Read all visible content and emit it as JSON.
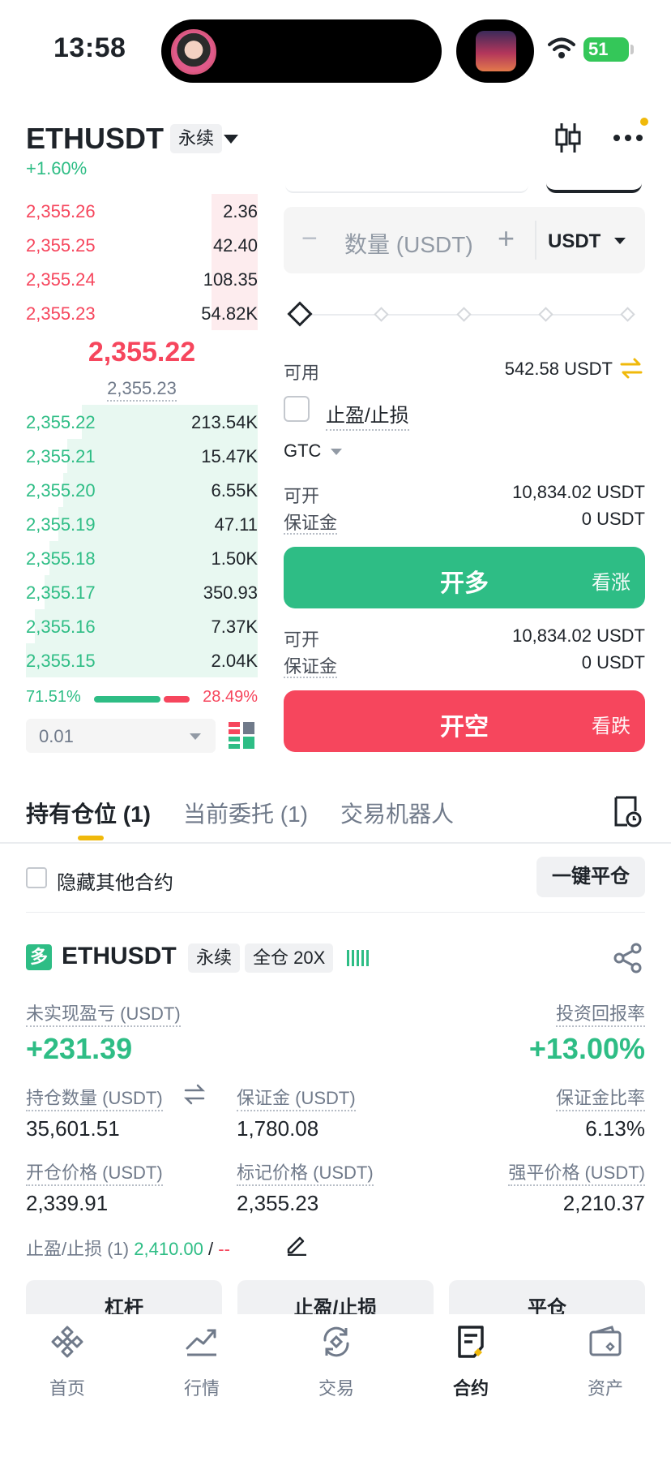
{
  "status_bar": {
    "time": "13:58",
    "battery": "51"
  },
  "header": {
    "symbol": "ETHUSDT",
    "type_badge": "永续",
    "change": "+1.60%"
  },
  "orderbook": {
    "asks": [
      {
        "price": "2,355.26",
        "qty": "2.36",
        "depth": 0.2
      },
      {
        "price": "2,355.25",
        "qty": "42.40",
        "depth": 0.2
      },
      {
        "price": "2,355.24",
        "qty": "108.35",
        "depth": 0.2
      },
      {
        "price": "2,355.23",
        "qty": "54.82K",
        "depth": 0.2
      }
    ],
    "mid_price": "2,355.22",
    "mark_price": "2,355.23",
    "bids": [
      {
        "price": "2,355.22",
        "qty": "213.54K",
        "depth": 0.76
      },
      {
        "price": "2,355.21",
        "qty": "15.47K",
        "depth": 0.82
      },
      {
        "price": "2,355.20",
        "qty": "6.55K",
        "depth": 0.84
      },
      {
        "price": "2,355.19",
        "qty": "47.11",
        "depth": 0.86
      },
      {
        "price": "2,355.18",
        "qty": "1.50K",
        "depth": 0.9
      },
      {
        "price": "2,355.17",
        "qty": "350.93",
        "depth": 0.92
      },
      {
        "price": "2,355.16",
        "qty": "7.37K",
        "depth": 0.96
      },
      {
        "price": "2,355.15",
        "qty": "2.04K",
        "depth": 1.0
      }
    ],
    "buy_ratio": "71.51%",
    "sell_ratio": "28.49%",
    "depth_step": "0.01"
  },
  "order_form": {
    "qty_placeholder": "数量 (USDT)",
    "qty_minus": "−",
    "qty_plus": "+",
    "qty_unit": "USDT",
    "available_label": "可用",
    "available_value": "542.58 USDT",
    "tpsl_label": "止盈/止损",
    "time_in_force": "GTC",
    "long_max_label": "可开",
    "long_max_value": "10,834.02 USDT",
    "long_margin_label": "保证金",
    "long_margin_value": "0 USDT",
    "long_button": "开多",
    "long_sub": "看涨",
    "short_max_label": "可开",
    "short_max_value": "10,834.02 USDT",
    "short_margin_label": "保证金",
    "short_margin_value": "0 USDT",
    "short_button": "开空",
    "short_sub": "看跌"
  },
  "tabs": [
    "持有仓位 (1)",
    "当前委托 (1)",
    "交易机器人"
  ],
  "positions_toolbar": {
    "hide_other": "隐藏其他合约",
    "close_all": "一键平仓"
  },
  "position": {
    "side_badge": "多",
    "symbol": "ETHUSDT",
    "type_badge": "永续",
    "margin_mode": "全仓 20X",
    "unrealized_label": "未实现盈亏 (USDT)",
    "unrealized_value": "+231.39",
    "roe_label": "投资回报率",
    "roe_value": "+13.00%",
    "size_label": "持仓数量 (USDT)",
    "size_value": "35,601.51",
    "margin_label": "保证金 (USDT)",
    "margin_value": "1,780.08",
    "margin_ratio_label": "保证金比率",
    "margin_ratio_value": "6.13%",
    "entry_label": "开仓价格 (USDT)",
    "entry_value": "2,339.91",
    "mark_label": "标记价格 (USDT)",
    "mark_value": "2,355.23",
    "liq_label": "强平价格 (USDT)",
    "liq_value": "2,210.37",
    "tpsl_label": "止盈/止损 (1)",
    "tp_value": "2,410.00",
    "tpsl_sep": "/",
    "sl_value": "--",
    "buttons": [
      "杠杆",
      "止盈/止损",
      "平仓"
    ]
  },
  "bottom_nav": [
    {
      "label": "首页",
      "icon": "home-icon"
    },
    {
      "label": "行情",
      "icon": "markets-icon"
    },
    {
      "label": "交易",
      "icon": "trade-icon"
    },
    {
      "label": "合约",
      "icon": "futures-icon"
    },
    {
      "label": "资产",
      "icon": "wallet-icon"
    }
  ],
  "colors": {
    "green": "#2ebd85",
    "red": "#f6465d",
    "accent": "#f0b90b"
  }
}
